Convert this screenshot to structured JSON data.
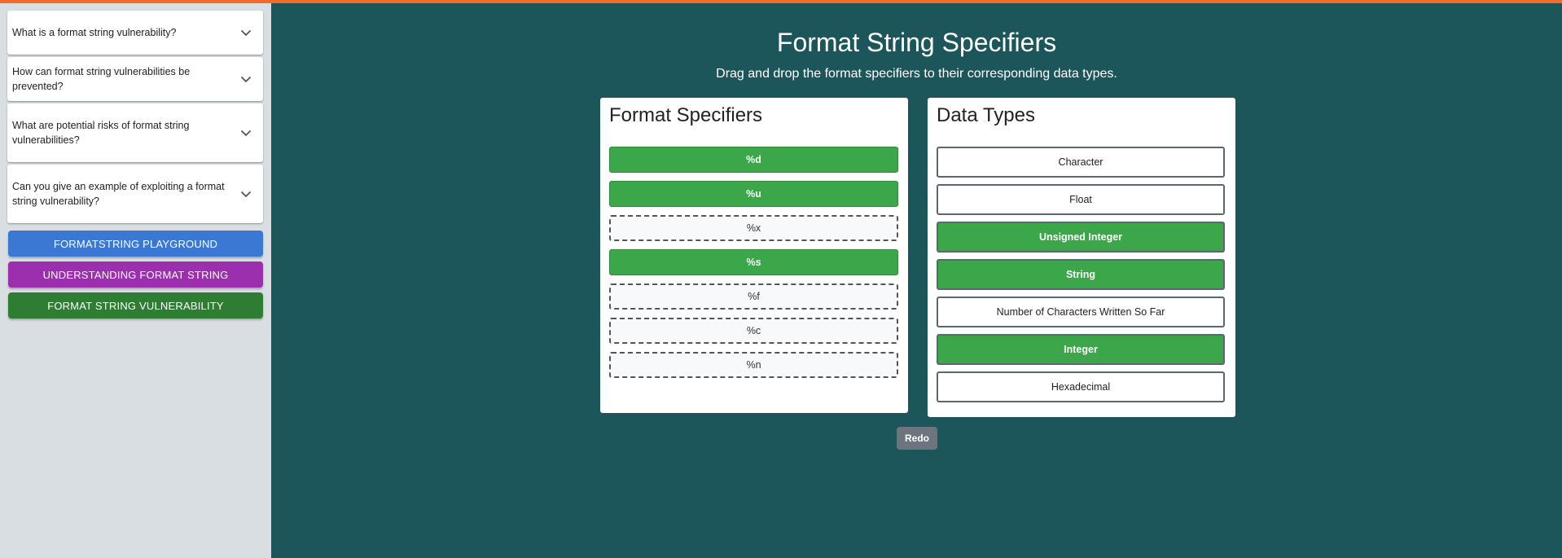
{
  "sidebar": {
    "faqs": [
      {
        "question": "What is a format string vulnerability?"
      },
      {
        "question": "How can format string vulnerabilities be prevented?"
      },
      {
        "question": "What are potential risks of format string vulnerabilities?"
      },
      {
        "question": "Can you give an example of exploiting a format string vulnerability?"
      }
    ],
    "nav": [
      {
        "label": "FORMATSTRING PLAYGROUND",
        "color": "#3a78d4"
      },
      {
        "label": "UNDERSTANDING FORMAT STRING",
        "color": "#9b2fae"
      },
      {
        "label": "FORMAT STRING VULNERABILITY",
        "color": "#2f7d32"
      }
    ]
  },
  "main": {
    "title": "Format String Specifiers",
    "subtitle": "Drag and drop the format specifiers to their corresponding data types.",
    "specifiers_panel": {
      "heading": "Format Specifiers",
      "items": [
        {
          "label": "%d",
          "state": "placed"
        },
        {
          "label": "%u",
          "state": "placed"
        },
        {
          "label": "%x",
          "state": "free"
        },
        {
          "label": "%s",
          "state": "placed"
        },
        {
          "label": "%f",
          "state": "free"
        },
        {
          "label": "%c",
          "state": "free"
        },
        {
          "label": "%n",
          "state": "free"
        }
      ]
    },
    "types_panel": {
      "heading": "Data Types",
      "items": [
        {
          "label": "Character",
          "state": "empty"
        },
        {
          "label": "Float",
          "state": "empty"
        },
        {
          "label": "Unsigned Integer",
          "state": "filled"
        },
        {
          "label": "String",
          "state": "filled"
        },
        {
          "label": "Number of Characters Written So Far",
          "state": "empty"
        },
        {
          "label": "Integer",
          "state": "filled"
        },
        {
          "label": "Hexadecimal",
          "state": "empty"
        }
      ]
    },
    "redo_label": "Redo"
  },
  "colors": {
    "accent_bar": "#f26b2a",
    "main_bg": "#1c555a",
    "sidebar_bg": "#d9dee2",
    "matched_green": "#3ca64a"
  },
  "icons": {
    "faq_toggle": "chevron-down-icon"
  }
}
